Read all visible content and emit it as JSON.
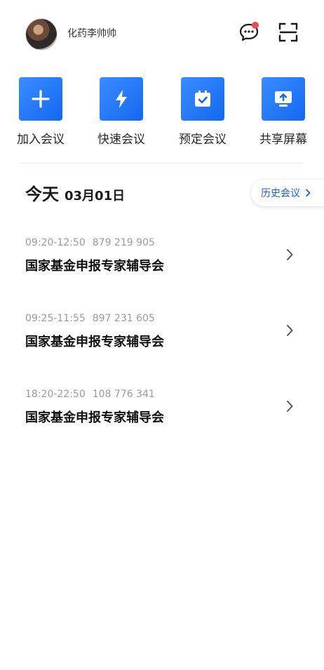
{
  "header": {
    "username": "化药李帅帅",
    "icons": {
      "avatar": "user-avatar",
      "chat": "chat-bubble-icon",
      "scan": "scan-icon"
    },
    "notification_dot": true
  },
  "actions": [
    {
      "label": "加入会议",
      "icon": "plus-icon"
    },
    {
      "label": "快速会议",
      "icon": "lightning-icon"
    },
    {
      "label": "预定会议",
      "icon": "calendar-check-icon"
    },
    {
      "label": "共享屏幕",
      "icon": "screen-share-icon"
    }
  ],
  "today": {
    "label": "今天",
    "date": "03月01日"
  },
  "history_button": {
    "label": "历史会议"
  },
  "meetings": [
    {
      "time": "09:20-12:50",
      "id": "879 219 905",
      "title": "国家基金申报专家辅导会"
    },
    {
      "time": "09:25-11:55",
      "id": "897 231 605",
      "title": "国家基金申报专家辅导会"
    },
    {
      "time": "18:20-22:50",
      "id": "108 776 341",
      "title": "国家基金申报专家辅导会"
    }
  ],
  "colors": {
    "accent": "#1368f0",
    "link": "#1b5fd6",
    "badge": "#f24a4a"
  }
}
